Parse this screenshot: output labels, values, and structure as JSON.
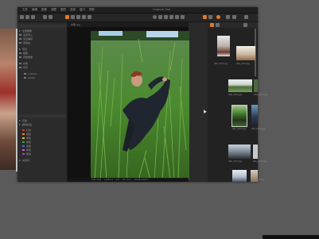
{
  "app": {
    "menus": [
      "文件",
      "编辑",
      "图像",
      "调整",
      "图层",
      "选择",
      "窗口",
      "帮助"
    ],
    "window_title": "Capture One"
  },
  "viewer": {
    "header": "肖像.jpg",
    "footer": [
      "ISO 100",
      "1/250 s",
      "f/4",
      "85 mm",
      "2048×3072"
    ]
  },
  "library": {
    "collections": [
      "全部图像",
      "最近导入",
      "最近捕获",
      "回收站",
      "项目",
      "相册",
      "智能相册",
      "肖像",
      "风景",
      "outdoor",
      "studio"
    ],
    "filters": [
      "评级",
      "颜色标签",
      "关键词"
    ],
    "color_labels": [
      {
        "name": "红色",
        "color": "#d23b3b"
      },
      {
        "name": "橙色",
        "color": "#e08a2a"
      },
      {
        "name": "黄色",
        "color": "#d8c72c"
      },
      {
        "name": "绿色",
        "color": "#3aa84b"
      },
      {
        "name": "蓝色",
        "color": "#3b6fd2"
      },
      {
        "name": "粉色",
        "color": "#d95aa8"
      },
      {
        "name": "紫色",
        "color": "#8a4ad2"
      }
    ]
  },
  "browser": {
    "thumbs": [
      {
        "caption": "IMG_0101.jpg"
      },
      {
        "caption": "IMG_0102.jpg"
      },
      {
        "caption": "IMG_0103.jpg"
      },
      {
        "caption": "IMG_0104.jpg"
      },
      {
        "caption": "IMG_0105.jpg"
      },
      {
        "caption": "IMG_0106.jpg"
      },
      {
        "caption": "IMG_0107.jpg"
      },
      {
        "caption": "IMG_0108.jpg"
      },
      {
        "caption": "IMG_0109.jpg"
      },
      {
        "caption": "IMG_0110.jpg"
      }
    ]
  },
  "colors": {
    "accent": "#e07a28",
    "grass": "#3f7d2a"
  }
}
